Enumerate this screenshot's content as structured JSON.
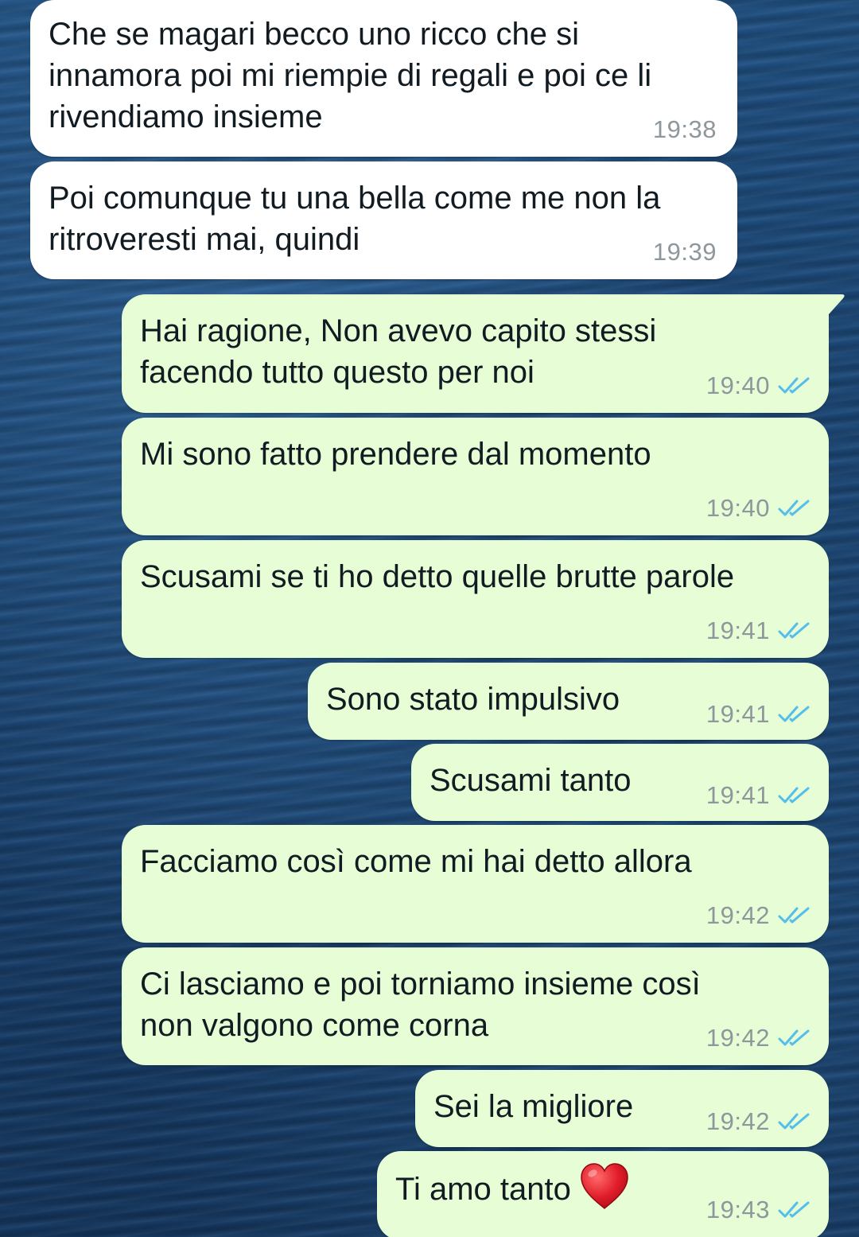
{
  "messages": [
    {
      "direction": "incoming",
      "text": "Che se magari becco uno ricco che si\ninnamora poi mi riempie di regali e poi ce li\nrivendiamo insieme",
      "time": "19:38"
    },
    {
      "direction": "incoming",
      "text": "Poi comunque tu una bella come me non la\nritroveresti mai, quindi",
      "time": "19:39"
    },
    {
      "direction": "outgoing",
      "text": "Hai ragione, Non avevo capito stessi\nfacendo tutto questo per noi",
      "time": "19:40",
      "status": "read"
    },
    {
      "direction": "outgoing",
      "text": "Mi sono fatto prendere dal momento",
      "time": "19:40",
      "status": "read"
    },
    {
      "direction": "outgoing",
      "text": "Scusami se ti ho detto quelle brutte parole",
      "time": "19:41",
      "status": "read"
    },
    {
      "direction": "outgoing",
      "text": "Sono stato impulsivo",
      "time": "19:41",
      "status": "read"
    },
    {
      "direction": "outgoing",
      "text": "Scusami tanto",
      "time": "19:41",
      "status": "read"
    },
    {
      "direction": "outgoing",
      "text": "Facciamo così come mi hai detto allora",
      "time": "19:42",
      "status": "read"
    },
    {
      "direction": "outgoing",
      "text": "Ci lasciamo e poi torniamo insieme così\nnon valgono come corna",
      "time": "19:42",
      "status": "read"
    },
    {
      "direction": "outgoing",
      "text": "Sei la migliore",
      "time": "19:42",
      "status": "read"
    },
    {
      "direction": "outgoing",
      "text": "Ti amo tanto",
      "emoji": "red-heart",
      "time": "19:43",
      "status": "read"
    }
  ],
  "colors": {
    "incoming_bubble": "#ffffff",
    "outgoing_bubble": "#e7fdd6",
    "read_ticks": "#53bdeb",
    "timestamp": "#8e979c",
    "background": "#1a4472"
  },
  "icons": {
    "read_receipt": "double-check-icon",
    "emoji": "red-heart-icon"
  }
}
